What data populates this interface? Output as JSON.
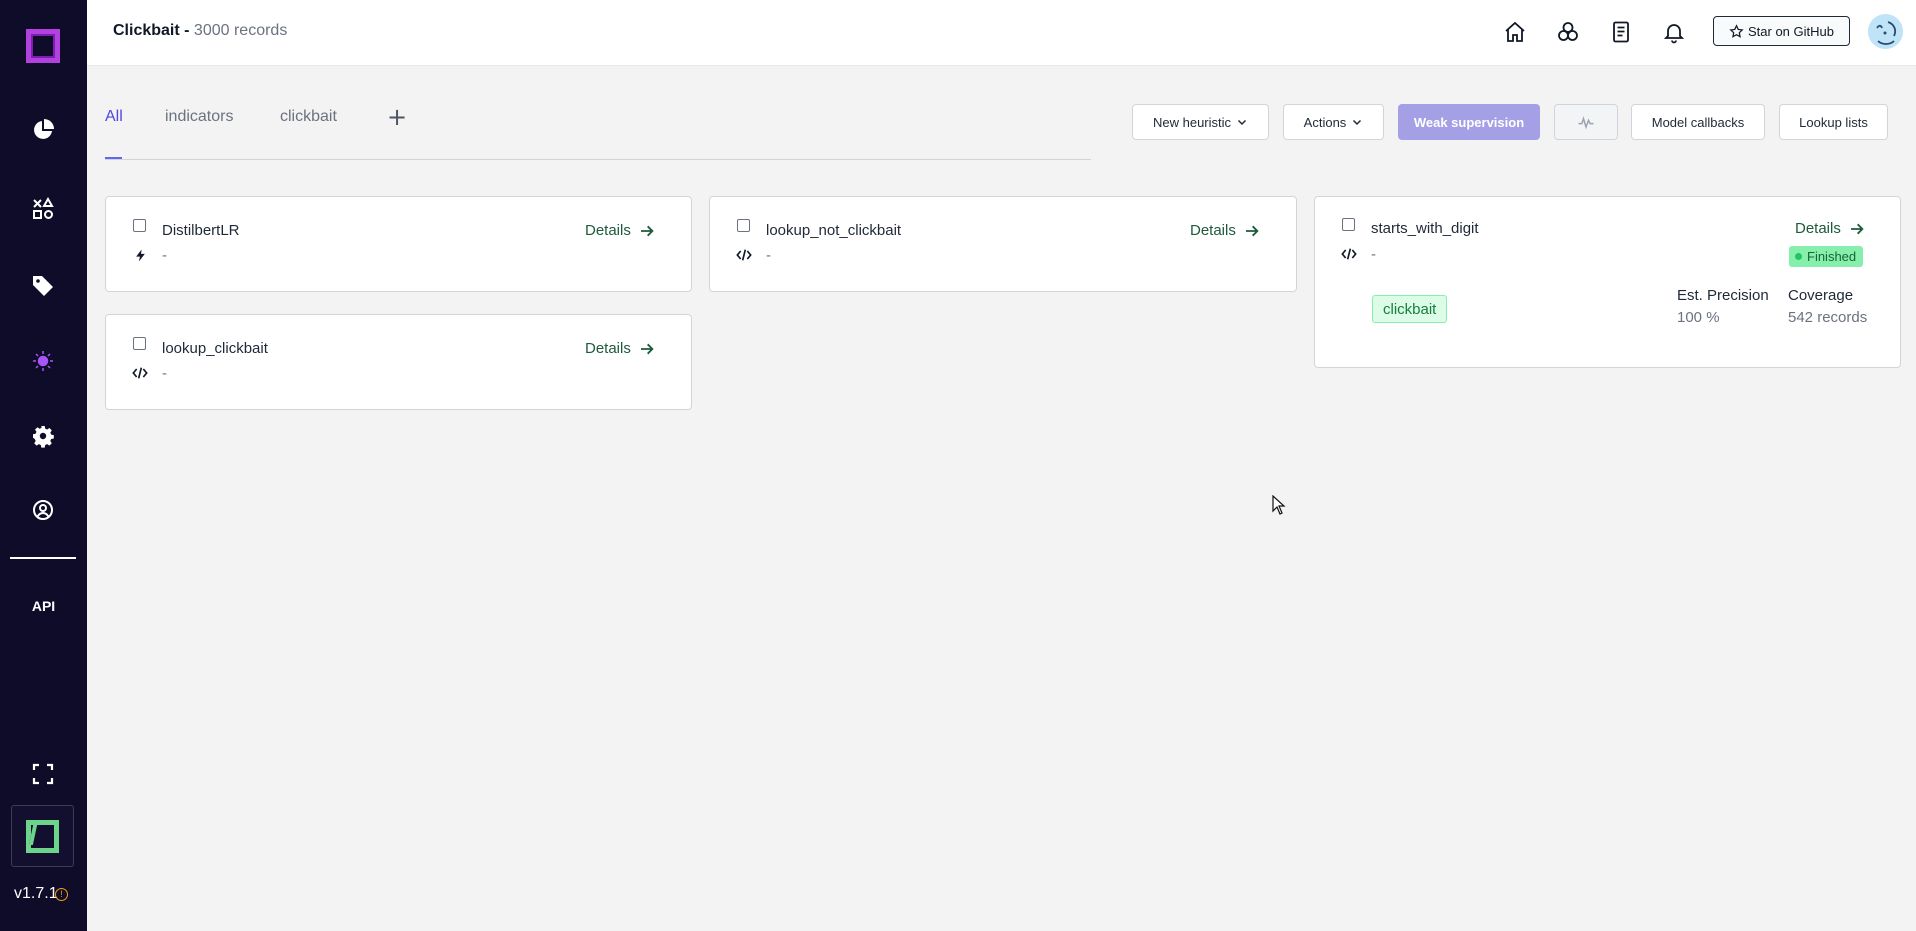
{
  "sidebar": {
    "api_label": "API",
    "version": "v1.7.1",
    "version_info_icon": "!"
  },
  "header": {
    "project_name": "Clickbait -",
    "record_count": "3000 records",
    "github_button": "Star on GitHub"
  },
  "tabs": {
    "items": [
      "All",
      "indicators",
      "clickbait"
    ],
    "add_label": "+"
  },
  "toolbar": {
    "new_heuristic": "New heuristic",
    "actions": "Actions",
    "weak_supervision": "Weak supervision",
    "model_callbacks": "Model callbacks",
    "lookup_lists": "Lookup lists"
  },
  "cards": [
    {
      "name": "DistilbertLR",
      "type_icon": "lightning-icon",
      "description": "-",
      "details_label": "Details"
    },
    {
      "name": "lookup_not_clickbait",
      "type_icon": "code-icon",
      "description": "-",
      "details_label": "Details"
    },
    {
      "name": "starts_with_digit",
      "type_icon": "code-icon",
      "description": "-",
      "details_label": "Details",
      "status": "Finished",
      "label": "clickbait",
      "precision_label": "Est. Precision",
      "precision_value": "100 %",
      "coverage_label": "Coverage",
      "coverage_value": "542 records"
    },
    {
      "name": "lookup_clickbait",
      "type_icon": "code-icon",
      "description": "-",
      "details_label": "Details"
    }
  ],
  "colors": {
    "sidebar_bg": "#0f0c29",
    "accent": "#6366f1",
    "primary_button": "#a5a0e6",
    "details_link": "#1e5a3c",
    "finished_badge": "#86efac"
  }
}
